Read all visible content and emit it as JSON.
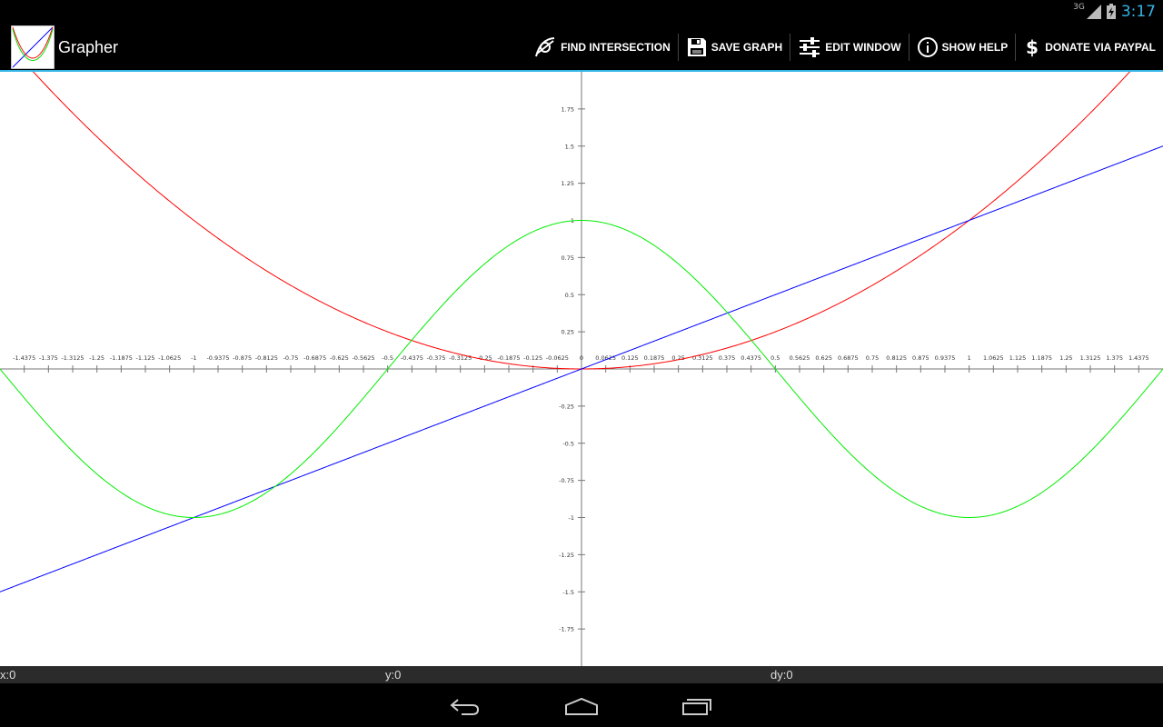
{
  "status_bar": {
    "network_type": "3G",
    "time": "3:17"
  },
  "app": {
    "title": "Grapher"
  },
  "actions": [
    {
      "label": "FIND INTERSECTION",
      "icon": "intersection-icon"
    },
    {
      "label": "SAVE GRAPH",
      "icon": "save-icon"
    },
    {
      "label": "EDIT WINDOW",
      "icon": "sliders-icon"
    },
    {
      "label": "SHOW HELP",
      "icon": "info-icon"
    },
    {
      "label": "DONATE VIA PAYPAL",
      "icon": "dollar-icon"
    }
  ],
  "readout": {
    "x": "x:0",
    "y": "y:0",
    "dy": "dy:0"
  },
  "nav": {
    "back": "back-icon",
    "home": "home-icon",
    "recents": "recents-icon"
  },
  "chart_data": {
    "type": "line",
    "xlim": [
      -1.5,
      1.5
    ],
    "ylim": [
      -2,
      2
    ],
    "x_tick_step": 0.0625,
    "y_tick_step": 0.25,
    "x_tick_labels": [
      "-1.4375",
      "-1.375",
      "-1.3125",
      "-1.25",
      "-1.1875",
      "-1.125",
      "-1.0625",
      "-1",
      "-0.9375",
      "-0.875",
      "-0.8125",
      "-0.75",
      "-0.6875",
      "-0.625",
      "-0.5625",
      "-0.5",
      "-0.4375",
      "-0.375",
      "-0.3125",
      "-0.25",
      "-0.1875",
      "-0.125",
      "-0.0625",
      "0",
      "0.0625",
      "0.125",
      "0.1875",
      "0.25",
      "0.3125",
      "0.375",
      "0.4375",
      "0.5",
      "0.5625",
      "0.625",
      "0.6875",
      "0.75",
      "0.8125",
      "0.875",
      "0.9375",
      "1",
      "1.0625",
      "1.125",
      "1.1875",
      "1.25",
      "1.3125",
      "1.375",
      "1.4375"
    ],
    "y_tick_labels": [
      "1.75",
      "1.5",
      "1.25",
      "1",
      "0.75",
      "0.5",
      "0.25",
      "-0.25",
      "-0.5",
      "-0.75",
      "-1",
      "-1.25",
      "-1.5",
      "-1.75"
    ],
    "grid": false,
    "series": [
      {
        "formula": "y = x^2",
        "color": "#ff0000",
        "x": [
          -1.5,
          -1.25,
          -1,
          -0.75,
          -0.5,
          -0.25,
          0,
          0.25,
          0.5,
          0.75,
          1,
          1.25,
          1.5
        ],
        "y": [
          2.25,
          1.5625,
          1,
          0.5625,
          0.25,
          0.0625,
          0,
          0.0625,
          0.25,
          0.5625,
          1,
          1.5625,
          2.25
        ]
      },
      {
        "formula": "y = x",
        "color": "#0000ff",
        "x": [
          -1.5,
          -1,
          -0.5,
          0,
          0.5,
          1,
          1.5
        ],
        "y": [
          -1.5,
          -1,
          -0.5,
          0,
          0.5,
          1,
          1.5
        ]
      },
      {
        "formula": "y = cos(pi*x)",
        "color": "#00ee00",
        "x": [
          -1.5,
          -1.25,
          -1,
          -0.75,
          -0.5,
          -0.25,
          0,
          0.25,
          0.5,
          0.75,
          1,
          1.25,
          1.5
        ],
        "y": [
          0,
          -0.7071,
          -1,
          -0.7071,
          0,
          0.7071,
          1,
          0.7071,
          0,
          -0.7071,
          -1,
          -0.7071,
          0
        ]
      }
    ]
  }
}
